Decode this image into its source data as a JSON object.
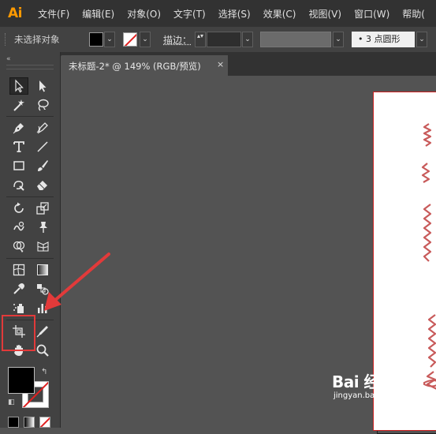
{
  "app": {
    "logo": "Ai",
    "menus": [
      "文件(F)",
      "编辑(E)",
      "对象(O)",
      "文字(T)",
      "选择(S)",
      "效果(C)",
      "视图(V)",
      "窗口(W)",
      "帮助("
    ]
  },
  "control_bar": {
    "selection_status": "未选择对象",
    "stroke_label": "描边：",
    "brush_preset": "•  3 点圆形",
    "dropdown_glyph": "⌄",
    "spinner_glyph": "▴▾"
  },
  "toolbar": {
    "collapse_glyph": "«",
    "highlighted_tool": "artboard-tool",
    "swap_glyph": "↰",
    "default_glyph": "◧"
  },
  "document": {
    "tab_title": "未标题-2* @ 149% (RGB/预览)",
    "close_glyph": "×"
  },
  "colors": {
    "accent_logo": "#ff9a00",
    "highlight_red": "#e23a3a",
    "zigzag_stroke": "#c85a5a",
    "fill": "#000000",
    "stroke_none": "#ffffff"
  },
  "watermark": {
    "main": "Bai 经验",
    "sub": "jingyan.baidu.com"
  }
}
